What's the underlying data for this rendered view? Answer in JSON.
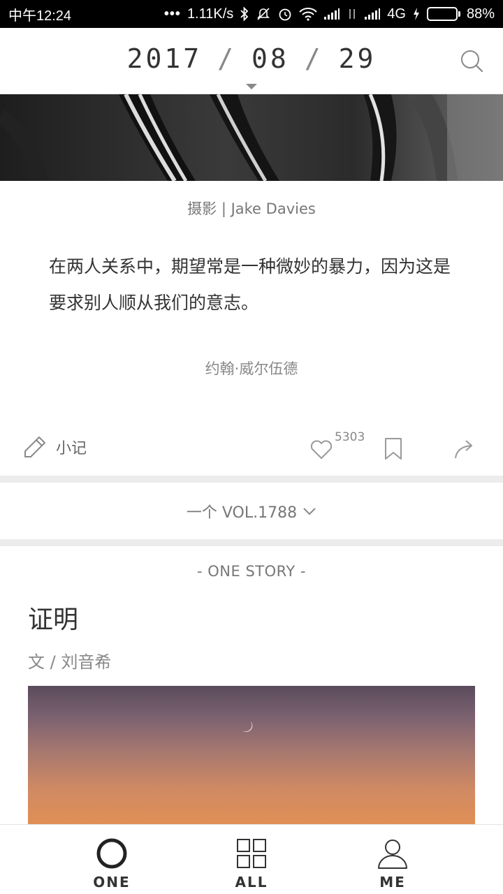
{
  "status_bar": {
    "time": "中午12:24",
    "dots": "•••",
    "network_speed": "1.11K/s",
    "network_type": "4G",
    "battery_level": 0.88,
    "battery_text": "88%",
    "icons": [
      "bluetooth-icon",
      "mute-icon",
      "alarm-icon",
      "wifi-icon",
      "signal-icon",
      "data-arrows-icon",
      "signal-icon",
      "charging-icon",
      "battery-icon"
    ]
  },
  "header": {
    "year": "2017",
    "month": "08",
    "day": "29",
    "separator": "/"
  },
  "card": {
    "photo_credit": "摄影 | Jake Davies",
    "quote": "在两人关系中，期望常是一种微妙的暴力，因为这是要求别人顺从我们的意志。",
    "quote_author": "约翰·威尔伍德",
    "note_label": "小记",
    "like_count": "5303"
  },
  "volume": {
    "label": "一个 VOL.1788"
  },
  "story": {
    "tag": "- ONE STORY -",
    "title": "证明",
    "author": "文 / 刘音希"
  },
  "bottom_nav": [
    {
      "label": "ONE",
      "icon": "one-circle-icon"
    },
    {
      "label": "ALL",
      "icon": "grid-icon"
    },
    {
      "label": "ME",
      "icon": "person-icon"
    }
  ],
  "colors": {
    "battery_green": "#4cd12a",
    "text_primary": "#333333",
    "text_secondary": "#777777",
    "divider": "#ececec"
  }
}
